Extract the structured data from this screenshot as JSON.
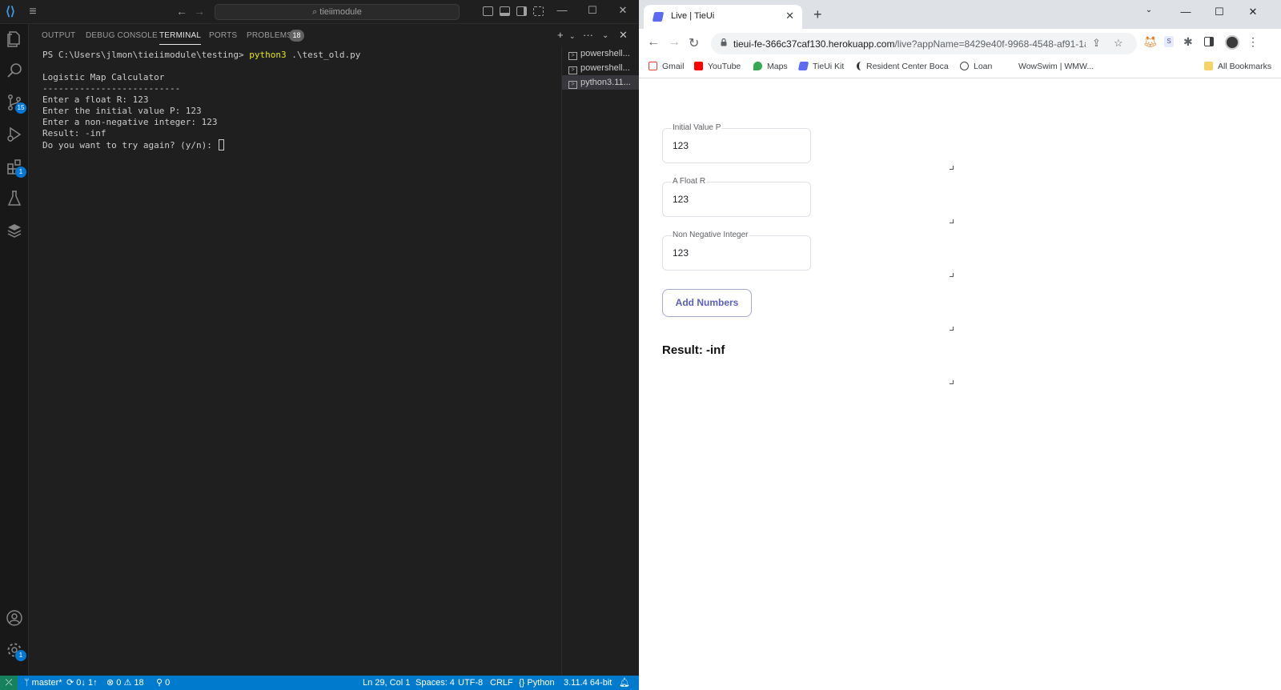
{
  "vscode": {
    "search_text": "tieiimodule",
    "panel_tabs": [
      {
        "label": "OUTPUT"
      },
      {
        "label": "DEBUG CONSOLE"
      },
      {
        "label": "TERMINAL"
      },
      {
        "label": "PORTS"
      },
      {
        "label": "PROBLEMS"
      }
    ],
    "problems_count": "18",
    "activity_badges": {
      "source_control": "15",
      "extensions": "1",
      "settings": "1"
    },
    "terminal": {
      "prompt": "PS C:\\Users\\jlmon\\tieiimodule\\testing> ",
      "command": "python3",
      "command_args": " .\\test_old.py",
      "lines": [
        "",
        "Logistic Map Calculator",
        "--------------------------",
        "Enter a float R: 123",
        "Enter the initial value P: 123",
        "Enter a non-negative integer: 123",
        "Result: -inf"
      ],
      "last_line": "Do you want to try again? (y/n): "
    },
    "terminal_list": [
      "powershell...",
      "powershell...",
      "python3.11..."
    ],
    "status": {
      "branch": "master*",
      "sync": "0↓ 1↑",
      "errors": "0",
      "warnings": "18",
      "ports": "0",
      "position": "Ln 29, Col 1",
      "spaces": "Spaces: 4",
      "encoding": "UTF-8",
      "eol": "CRLF",
      "language": "Python",
      "interpreter": "3.11.4 64-bit"
    }
  },
  "chrome": {
    "tab_title": "Live | TieUi",
    "url_host": "tieui-fe-366c37caf130.herokuapp.com",
    "url_rest": "/live?appName=8429e40f-9968-4548-af91-1a2...",
    "bookmarks": [
      "Gmail",
      "YouTube",
      "Maps",
      "TieUi Kit",
      "Resident Center Boca",
      "Loan",
      "WowSwim | WMW...",
      "All Bookmarks"
    ],
    "page": {
      "fields": [
        {
          "label": "Initial Value P",
          "value": "123"
        },
        {
          "label": "A Float R",
          "value": "123"
        },
        {
          "label": "Non Negative Integer",
          "value": "123"
        }
      ],
      "button_label": "Add Numbers",
      "result_text": "Result: -inf"
    }
  },
  "colors": {
    "vscode_bg": "#1f1f1f",
    "statusbar": "#007acc",
    "accent_button": "#5b5fb8",
    "terminal_command": "#e5e510"
  }
}
